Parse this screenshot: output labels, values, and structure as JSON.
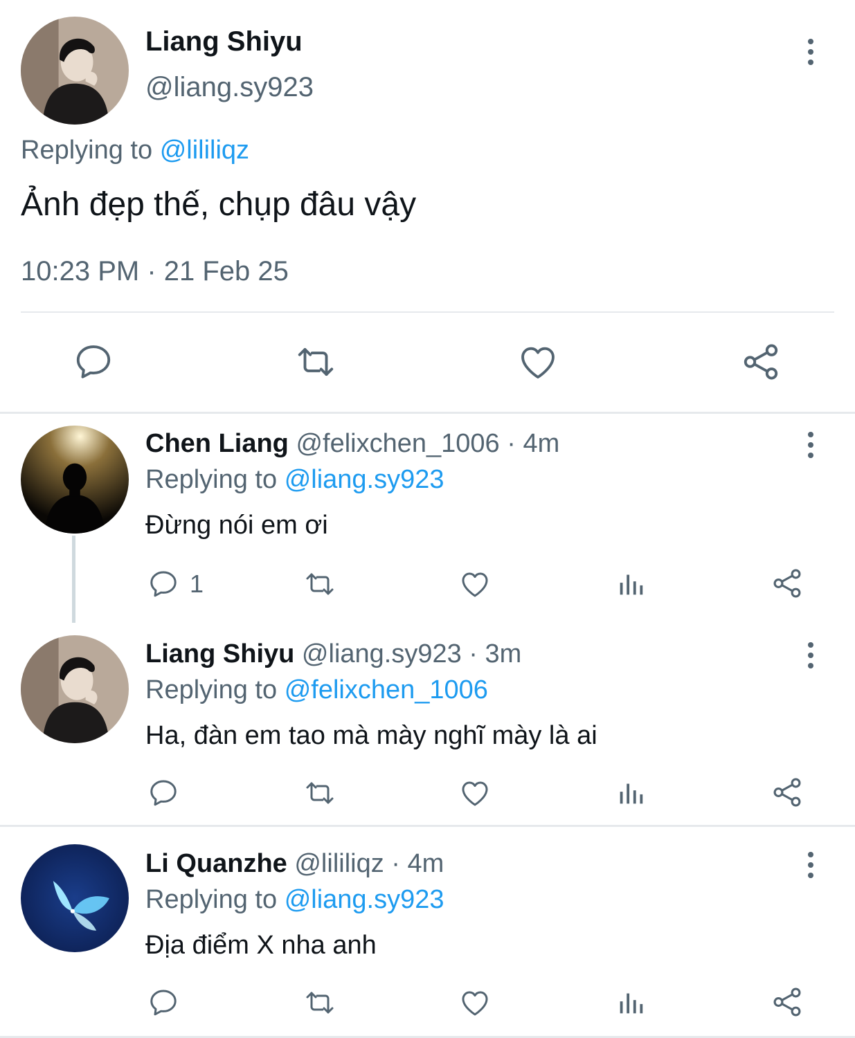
{
  "main_tweet": {
    "author_name": "Liang Shiyu",
    "author_handle": "@liang.sy923",
    "replying_prefix": "Replying to",
    "replying_to": "@lililiqz",
    "text": "Ảnh đẹp thế, chụp đâu vậy",
    "timestamp": "10:23 PM · 21 Feb 25",
    "actions": [
      "comment-icon",
      "retweet-icon",
      "heart-icon",
      "share-icon"
    ]
  },
  "replies": [
    {
      "author_name": "Chen Liang",
      "meta": "@felixchen_1006 · 4m",
      "replying_prefix": "Replying to",
      "replying_to": "@liang.sy923",
      "text": "Đừng nói em ơi",
      "comment_count": "1"
    },
    {
      "author_name": "Liang Shiyu",
      "meta": "@liang.sy923 · 3m",
      "replying_prefix": "Replying to",
      "replying_to": "@felixchen_1006",
      "text": "Ha, đàn em tao mà mày nghĩ mày là ai",
      "comment_count": ""
    },
    {
      "author_name": "Li Quanzhe",
      "meta": "@lililiqz · 4m",
      "replying_prefix": "Replying to",
      "replying_to": "@liang.sy923",
      "text": "Địa điểm X nha anh",
      "comment_count": ""
    }
  ],
  "colors": {
    "accent": "#1d9bf0",
    "secondary_text": "#536471",
    "primary_text": "#0f1419",
    "divider": "#e6e9ec"
  }
}
